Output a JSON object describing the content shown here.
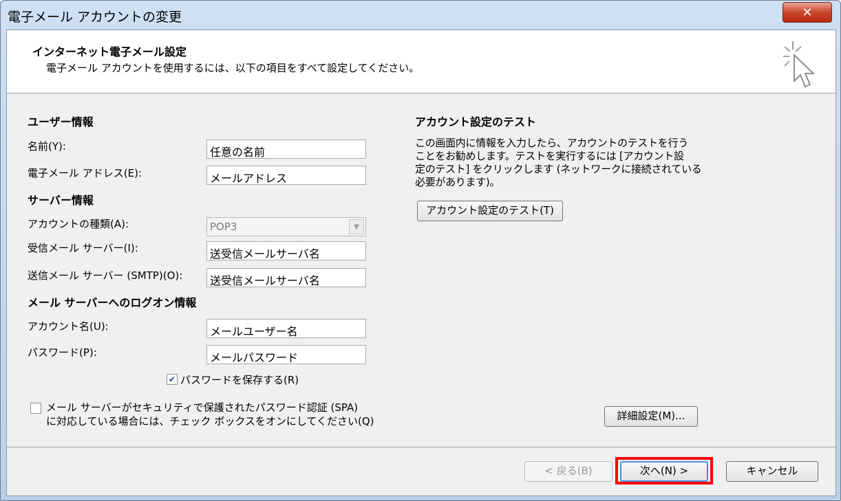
{
  "window": {
    "title": "電子メール アカウントの変更",
    "close_label": "✕"
  },
  "header": {
    "title": "インターネット電子メール設定",
    "subtitle": "電子メール アカウントを使用するには、以下の項目をすべて設定してください。"
  },
  "user_info": {
    "heading": "ユーザー情報",
    "name_label": "名前(Y):",
    "name_value": "任意の名前",
    "email_label": "電子メール アドレス(E):",
    "email_value": "メールアドレス"
  },
  "server_info": {
    "heading": "サーバー情報",
    "account_type_label": "アカウントの種類(A):",
    "account_type_value": "POP3",
    "incoming_label": "受信メール サーバー(I):",
    "incoming_value": "送受信メールサーバ名",
    "outgoing_label": "送信メール サーバー (SMTP)(O):",
    "outgoing_value": "送受信メールサーバ名"
  },
  "logon_info": {
    "heading": "メール サーバーへのログオン情報",
    "account_name_label": "アカウント名(U):",
    "account_name_value": "メールユーザー名",
    "password_label": "パスワード(P):",
    "password_value": "メールパスワード",
    "remember_label": "パスワードを保存する(R)",
    "remember_checked": true,
    "spa_line1": "メール サーバーがセキュリティで保護されたパスワード認証 (SPA)",
    "spa_line2": "に対応している場合には、チェック ボックスをオンにしてください(Q)",
    "spa_checked": false
  },
  "test": {
    "heading": "アカウント設定のテスト",
    "desc_line1": "この画面内に情報を入力したら、アカウントのテストを行う",
    "desc_line2": "ことをお勧めします。テストを実行するには [アカウント設",
    "desc_line3": "定のテスト] をクリックします (ネットワークに接続されている",
    "desc_line4": "必要があります)。",
    "button_label": "アカウント設定のテスト(T)"
  },
  "advanced_button": "詳細設定(M)...",
  "footer": {
    "back_label": "< 戻る(B)",
    "next_label": "次へ(N) >",
    "cancel_label": "キャンセル"
  },
  "colors": {
    "highlight": "#ff0000",
    "dialog_bg": "#f0f0f0",
    "close_button": "#c9452c"
  }
}
